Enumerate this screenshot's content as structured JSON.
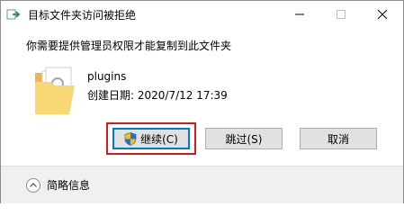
{
  "window": {
    "title": "目标文件夹访问被拒绝",
    "icon": "file-move-icon"
  },
  "controls": {
    "minimize_icon": "minimize-icon",
    "maximize_icon": "maximize-icon",
    "close_icon": "close-icon"
  },
  "message": "你需要提供管理员权限才能复制到此文件夹",
  "item": {
    "icon": "folder-icon",
    "name": "plugins",
    "date_label": "创建日期: 2020/7/12 17:39"
  },
  "buttons": {
    "continue_label": "继续(C)",
    "continue_icon": "uac-shield-icon",
    "skip_label": "跳过(S)",
    "cancel_label": "取消"
  },
  "footer": {
    "details_label": "简略信息",
    "details_icon": "chevron-up-circle-icon"
  },
  "colors": {
    "highlight": "#e0141e",
    "focus_border": "#0078d7",
    "footer_bg": "#f0f0f0",
    "folder": "#f8d775"
  }
}
